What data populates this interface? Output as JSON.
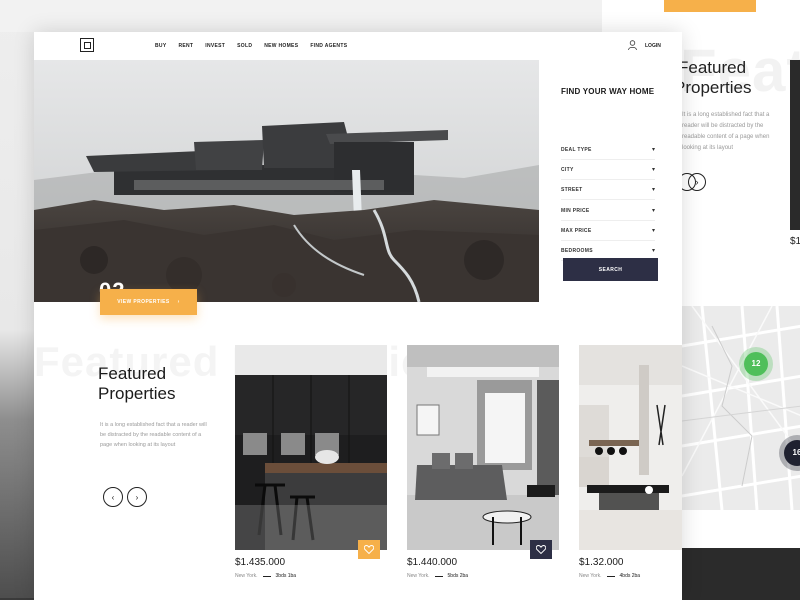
{
  "nav": {
    "links": [
      "BUY",
      "RENT",
      "INVEST",
      "SOLD",
      "NEW HOMES",
      "FIND AGENTS"
    ],
    "login": "LOGIN"
  },
  "hero": {
    "slide_number": "02",
    "view_button": "VIEW PROPERTIES",
    "view_button_icon": "chevron-right-icon"
  },
  "search": {
    "title": "FIND YOUR WAY HOME",
    "fields": [
      "DEAL TYPE",
      "CITY",
      "STREET",
      "MIN PRICE",
      "MAX PRICE",
      "BEDROOMS"
    ],
    "caret": "▾",
    "button": "SEARCH"
  },
  "featured": {
    "ghost": "Featured Properties",
    "title_line1": "Featured",
    "title_line2": "Properties",
    "description": "It is a long established fact that a reader will be distracted by the readable content of a page when looking at its layout",
    "prev_icon": "‹",
    "next_icon": "›"
  },
  "listings": [
    {
      "price": "$1.435.000",
      "city": "New York.",
      "beds": "3bds 1ba",
      "favorite_color": "#f6b04a"
    },
    {
      "price": "$1.440.000",
      "city": "New York.",
      "beds": "5bds 2ba",
      "favorite_color": "#2d2f45"
    },
    {
      "price": "$1.32.000",
      "city": "New York.",
      "beds": "4bds 2ba"
    }
  ],
  "back_card": {
    "title_line1": "Featured",
    "title_line2": "Properties",
    "ghost": "Feature",
    "description": "It is a long established fact that a reader will be distracted by the readable content of a page when looking at its layout",
    "price_partial": "$1,",
    "map_clusters": [
      "12",
      "16"
    ]
  },
  "colors": {
    "accent": "#f6b04a",
    "primary": "#2d2f45",
    "cluster_green": "#4fbf5a"
  }
}
